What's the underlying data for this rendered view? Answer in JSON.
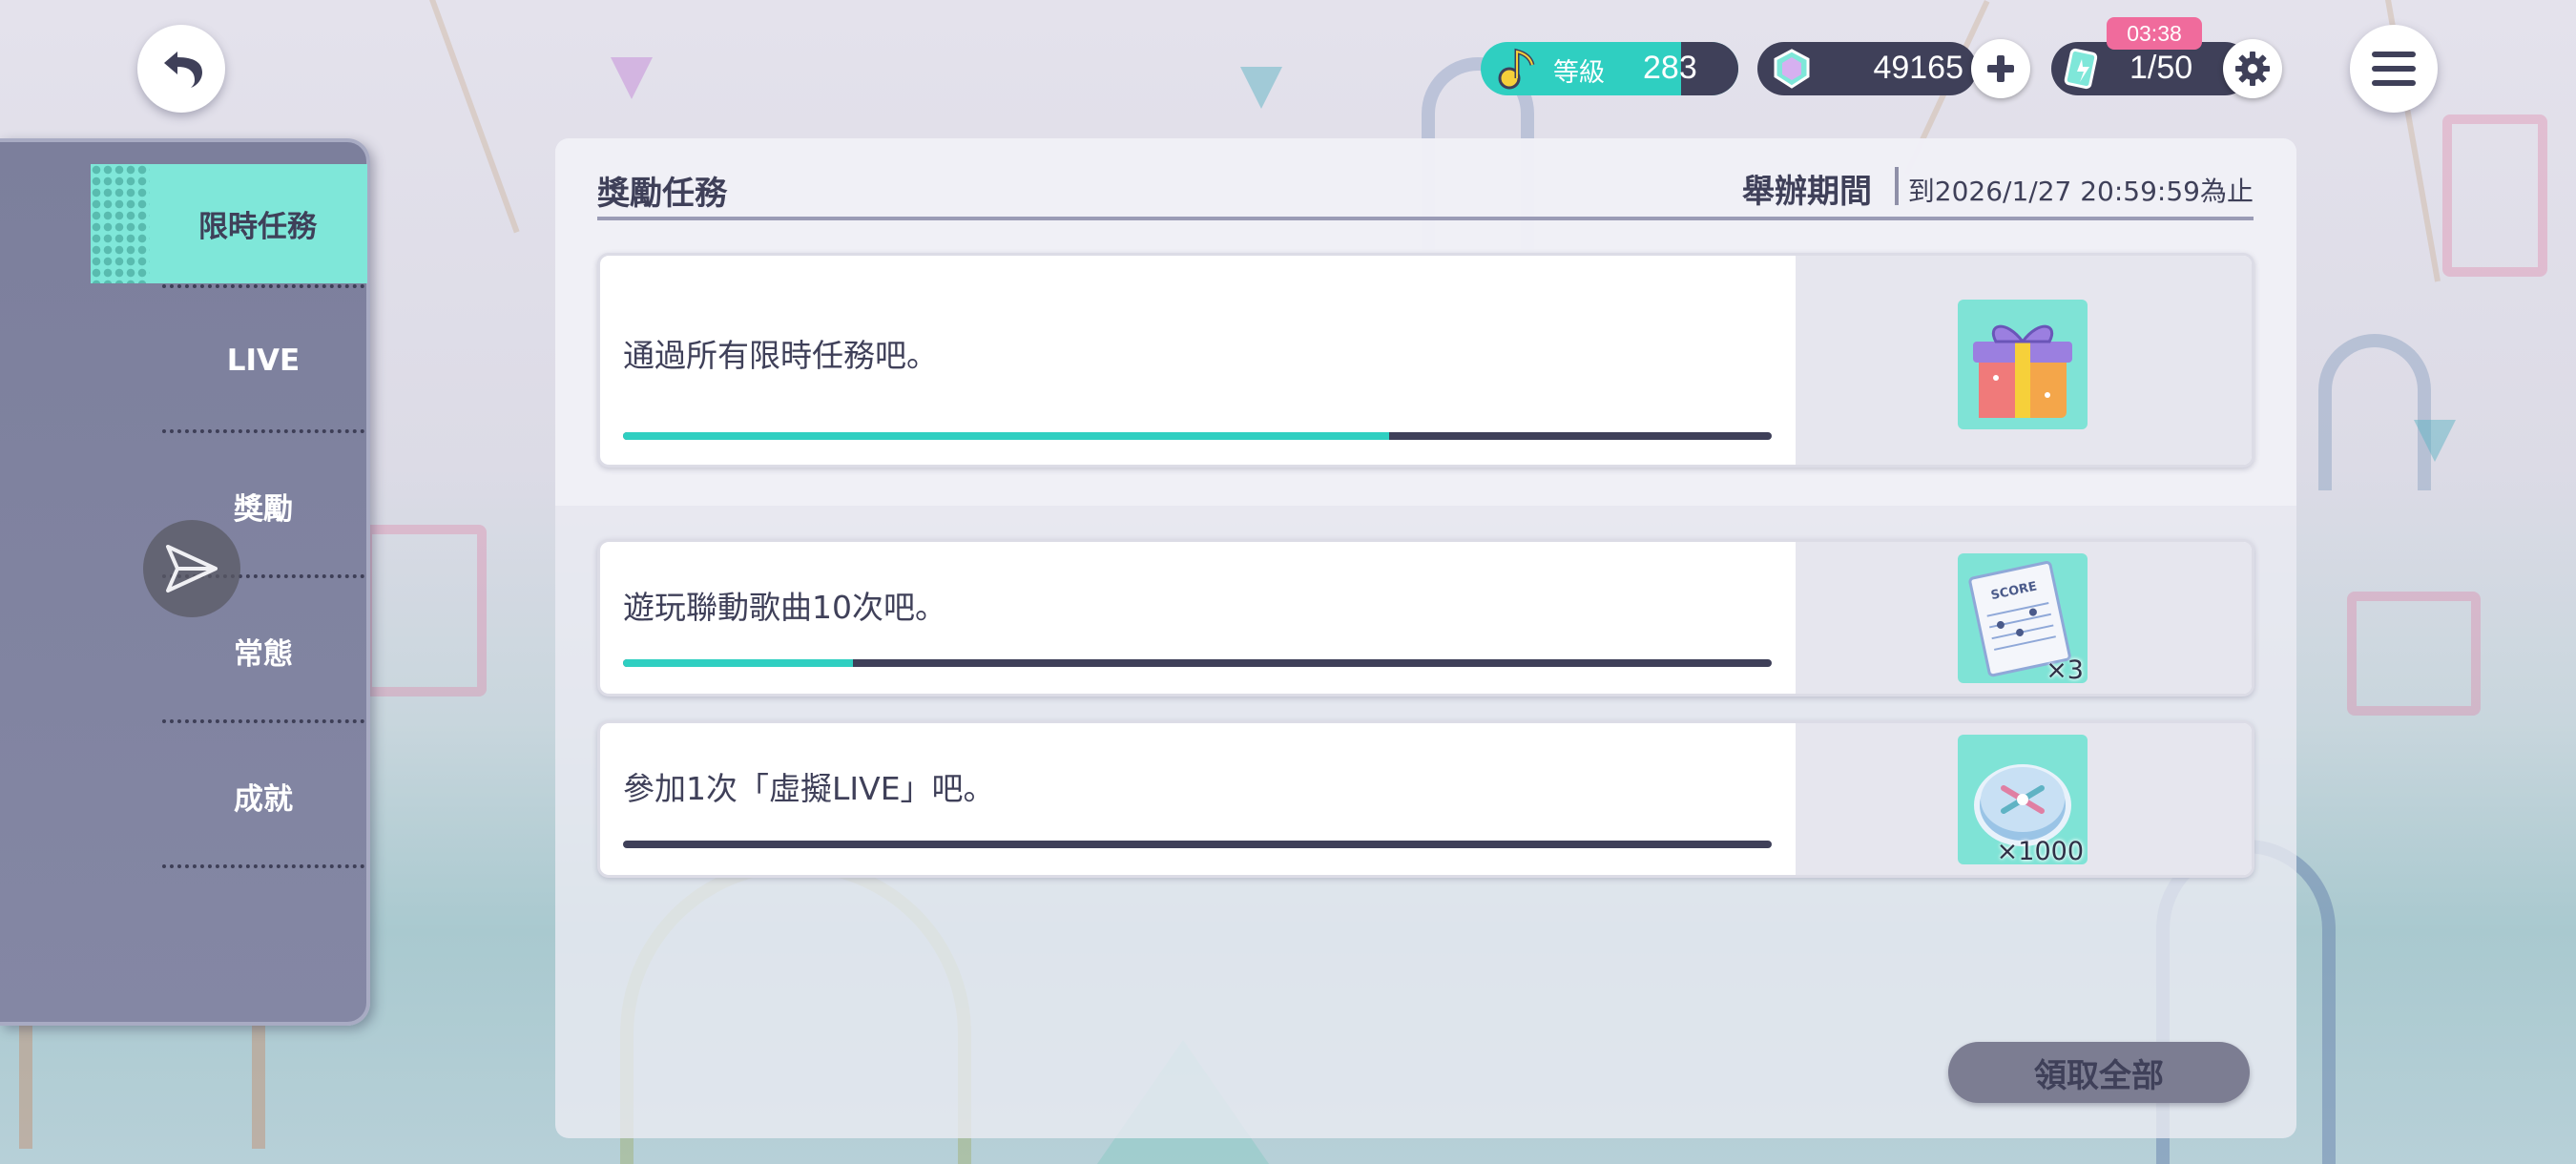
{
  "topbar": {
    "level_label": "等級",
    "level_value": "283",
    "currency_value": "49165",
    "stamina_timer": "03:38",
    "stamina_value": "1/50"
  },
  "sidebar": {
    "items": [
      {
        "label": "限時任務",
        "active": true
      },
      {
        "label": "LIVE",
        "active": false
      },
      {
        "label": "獎勵",
        "active": false
      },
      {
        "label": "常態",
        "active": false
      },
      {
        "label": "成就",
        "active": false
      }
    ]
  },
  "panel": {
    "title": "獎勵任務",
    "period_label": "舉辦期間",
    "period_value": "到2026/1/27 20:59:59為止"
  },
  "missions": [
    {
      "text": "通過所有限時任務吧。",
      "progress": 0.667,
      "reward": "gift-box-icon",
      "qty": ""
    },
    {
      "text": "遊玩聯動歌曲10次吧。",
      "progress": 0.2,
      "reward": "score-sheet-icon",
      "qty": "×3",
      "reward_text": "SCORE"
    },
    {
      "text": "參加1次「虛擬LIVE」吧。",
      "progress": 0.0,
      "reward": "compass-coin-icon",
      "qty": "×1000"
    }
  ],
  "claim_all_label": "領取全部",
  "colors": {
    "accent": "#7fe7d9",
    "progress_fill": "#2fcfc1",
    "dark": "#3f4059",
    "timer_badge": "#f06b9c"
  }
}
